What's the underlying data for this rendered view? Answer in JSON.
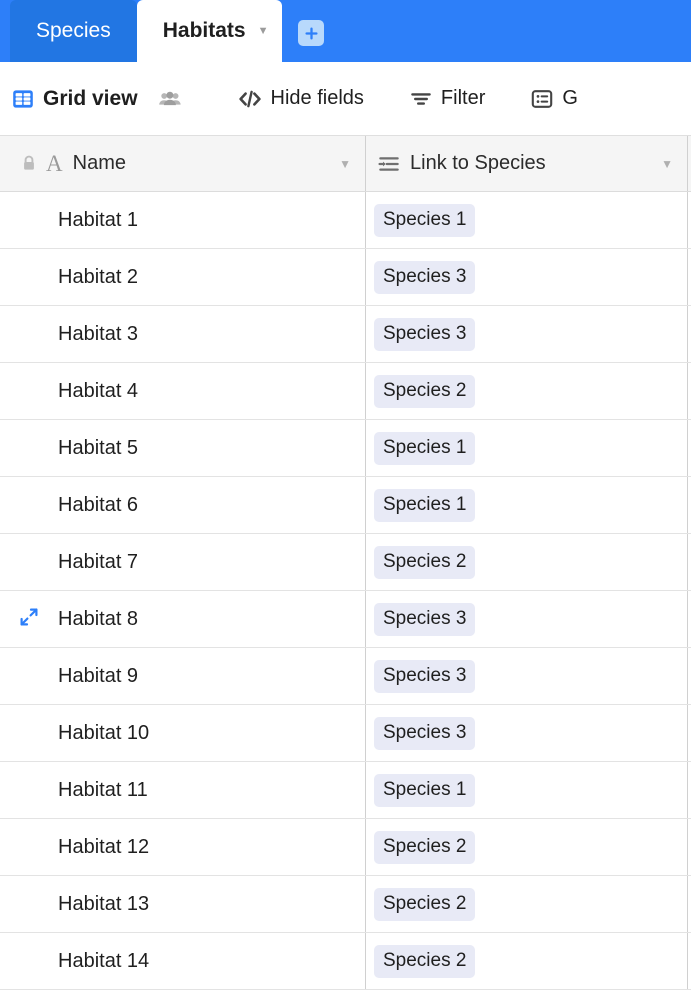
{
  "tabs": [
    {
      "label": "Species",
      "active": false,
      "has_caret": false
    },
    {
      "label": "Habitats",
      "active": true,
      "has_caret": true
    }
  ],
  "add_tab": {
    "icon": "plus-icon",
    "label": "+"
  },
  "toolbar": {
    "view_name": "Grid view",
    "view_icon": "grid-view-icon",
    "collaborators_icon": "people-icon",
    "hide_fields": {
      "label": "Hide fields",
      "icon": "code-brackets-icon"
    },
    "filter": {
      "label": "Filter",
      "icon": "filter-icon"
    },
    "group": {
      "label": "G",
      "icon": "group-icon"
    }
  },
  "grid": {
    "columns": [
      {
        "name": "Name",
        "type_icon": "text-field-icon",
        "locked_icon": "lock-icon",
        "caret": "▼"
      },
      {
        "name": "Link to Species",
        "type_icon": "link-record-icon",
        "caret": "▼"
      }
    ],
    "rows": [
      {
        "name": "Habitat 1",
        "link": "Species 1",
        "hovered": false
      },
      {
        "name": "Habitat 2",
        "link": "Species 3",
        "hovered": false
      },
      {
        "name": "Habitat 3",
        "link": "Species 3",
        "hovered": false
      },
      {
        "name": "Habitat 4",
        "link": "Species 2",
        "hovered": false
      },
      {
        "name": "Habitat 5",
        "link": "Species 1",
        "hovered": false
      },
      {
        "name": "Habitat 6",
        "link": "Species 1",
        "hovered": false
      },
      {
        "name": "Habitat 7",
        "link": "Species 2",
        "hovered": false
      },
      {
        "name": "Habitat 8",
        "link": "Species 3",
        "hovered": true
      },
      {
        "name": "Habitat 9",
        "link": "Species 3",
        "hovered": false
      },
      {
        "name": "Habitat 10",
        "link": "Species 3",
        "hovered": false
      },
      {
        "name": "Habitat 11",
        "link": "Species 1",
        "hovered": false
      },
      {
        "name": "Habitat 12",
        "link": "Species 2",
        "hovered": false
      },
      {
        "name": "Habitat 13",
        "link": "Species 2",
        "hovered": false
      },
      {
        "name": "Habitat 14",
        "link": "Species 2",
        "hovered": false
      }
    ]
  },
  "colors": {
    "brand_blue": "#2d7ff9",
    "tab_inactive_blue": "#2276e3",
    "chip_bg": "#e8eaf6",
    "expand_icon_blue": "#2d7ff9",
    "header_bg": "#f5f5f5"
  }
}
